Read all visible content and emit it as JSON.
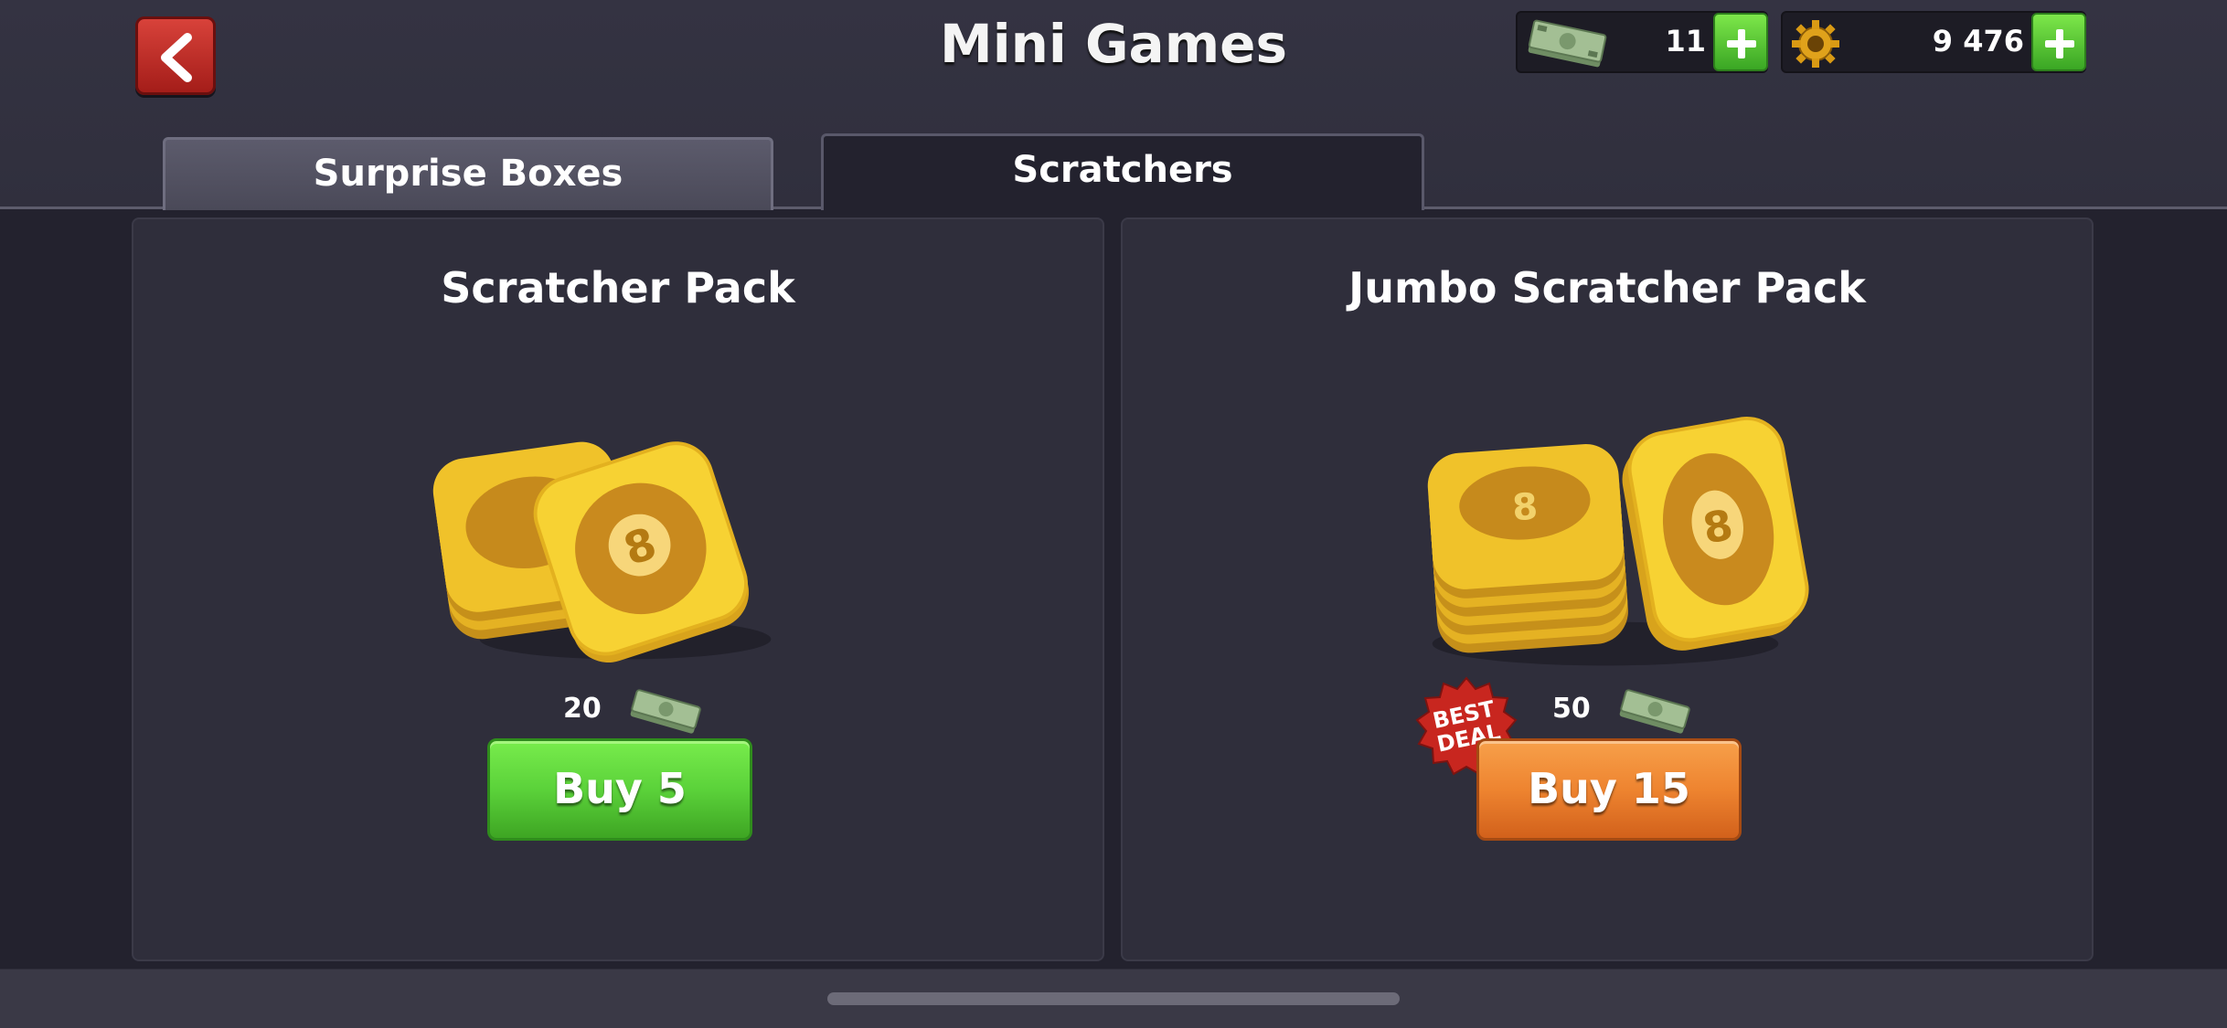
{
  "header": {
    "title": "Mini Games",
    "cash_amount": "11",
    "coins_amount": "9 476"
  },
  "tabs": [
    {
      "label": "Surprise Boxes",
      "active": false
    },
    {
      "label": "Scratchers",
      "active": true
    }
  ],
  "packs": [
    {
      "title": "Scratcher Pack",
      "price": "20",
      "button_label": "Buy 5",
      "button_color": "#5bd23a"
    },
    {
      "title": "Jumbo Scratcher Pack",
      "price": "50",
      "button_label": "Buy 15",
      "button_color": "#ee8430",
      "badge": [
        "BEST",
        "DEAL"
      ]
    }
  ],
  "colors": {
    "accent_green": "#5bd23a",
    "accent_orange": "#ee8430",
    "back_red": "#c62f28",
    "card_gold": "#f2c41c"
  }
}
